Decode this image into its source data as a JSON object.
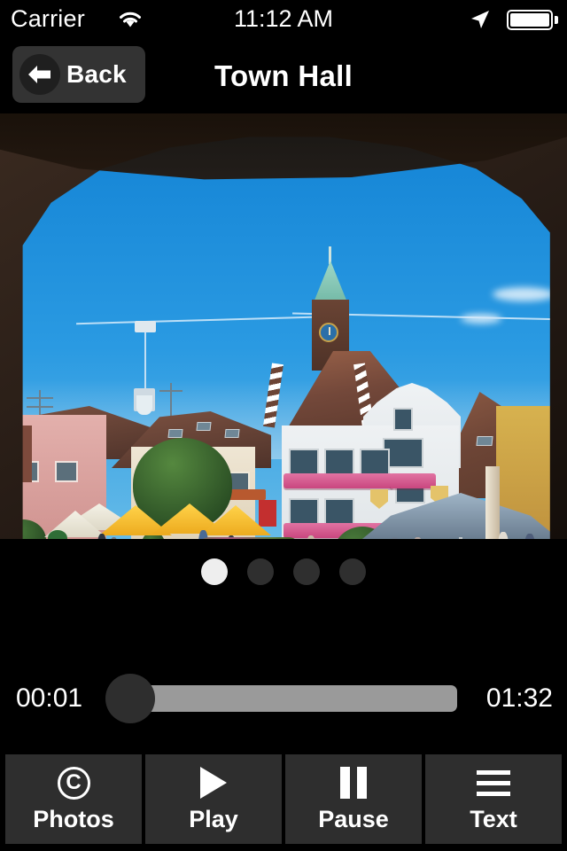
{
  "status_bar": {
    "carrier": "Carrier",
    "wifi_icon": "wifi-icon",
    "time": "11:12 AM",
    "location_icon": "location-arrow-icon",
    "battery_icon": "battery-full-icon"
  },
  "nav_bar": {
    "back_label": "Back",
    "back_icon": "arrow-left-icon",
    "title": "Town Hall"
  },
  "photo": {
    "alt": "Town hall square seen through a stone arch, with clock tower, cafe umbrellas and cobblestone plaza"
  },
  "pager": {
    "total": 4,
    "active_index": 0
  },
  "player": {
    "elapsed": "00:01",
    "duration": "01:32",
    "progress_percent": 1
  },
  "toolbar": {
    "buttons": [
      {
        "label": "Photos",
        "icon": "copyright-icon"
      },
      {
        "label": "Play",
        "icon": "play-icon"
      },
      {
        "label": "Pause",
        "icon": "pause-icon"
      },
      {
        "label": "Text",
        "icon": "hamburger-icon"
      }
    ]
  },
  "colors": {
    "background": "#000000",
    "panel": "#2e2e2e",
    "accent_text": "#ffffff",
    "track": "#9a9a9a",
    "thumb": "#2e2e2e",
    "dot_active": "#eeeeee",
    "dot_inactive": "#2f2f2f"
  }
}
